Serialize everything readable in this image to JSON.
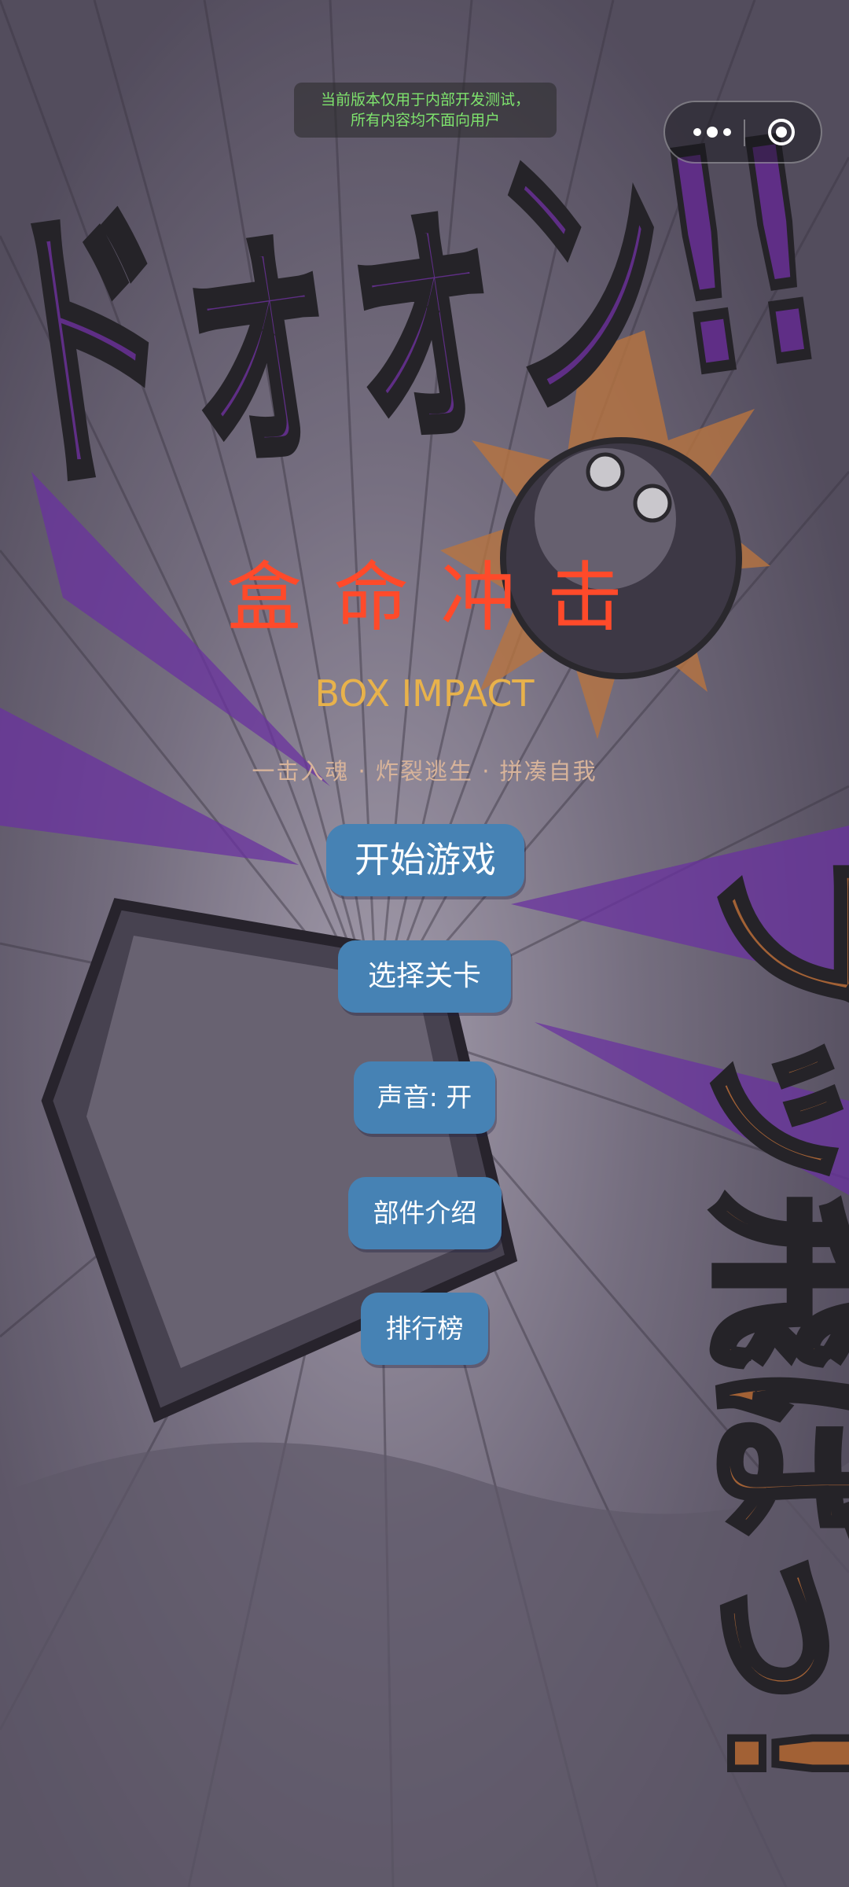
{
  "dev_notice": {
    "line1": "当前版本仅用于内部开发测试，",
    "line2": "所有内容均不面向用户"
  },
  "capsule": {
    "more_icon": "more-dots-icon",
    "close_icon": "mini-program-close-icon"
  },
  "game": {
    "title": "盒命冲击",
    "subtitle": "BOX IMPACT",
    "tagline": "一击入魂 · 炸裂逃生 · 拼凑自我"
  },
  "background": {
    "sfx_top": "ドォォン!!",
    "sfx_side": "ブッ飛ばっ!"
  },
  "menu": {
    "start": "开始游戏",
    "select_level": "选择关卡",
    "sound": "声音: 开",
    "parts_intro": "部件介绍",
    "leaderboard": "排行榜"
  },
  "colors": {
    "title": "#ff4a2a",
    "subtitle": "#e8b24b",
    "button": "#4682b4",
    "sfx_purple": "#5a1a8c",
    "sfx_orange": "#b8601c"
  }
}
